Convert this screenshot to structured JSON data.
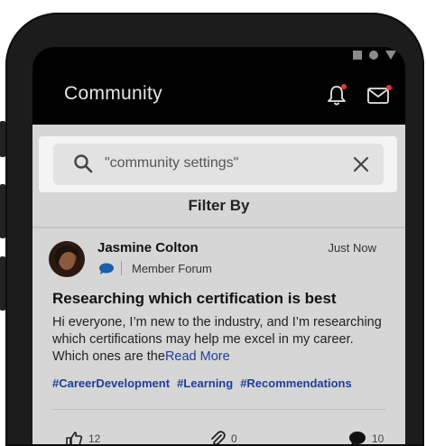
{
  "app": {
    "title": "Community"
  },
  "search": {
    "query": "\"community settings\""
  },
  "filter": {
    "label": "Filter By"
  },
  "post": {
    "author": "Jasmine Colton",
    "time": "Just Now",
    "forum": "Member Forum",
    "title": "Researching which certification is best",
    "body": "Hi everyone, I’m new to the industry, and I’m researching which certifications may help me excel in my career. Which ones are the",
    "read_more": "Read More",
    "tags": [
      "#CareerDevelopment",
      "#Learning",
      "#Recommendations"
    ],
    "likes": "12",
    "attachments": "0",
    "comments": "10"
  },
  "colors": {
    "accent": "#1d3f9a",
    "notification_dot": "#e53935"
  },
  "icons": [
    "bell-icon",
    "mail-icon",
    "search-icon",
    "close-icon",
    "chat-bubble-icon",
    "thumbs-up-icon",
    "paperclip-icon",
    "comment-icon"
  ]
}
